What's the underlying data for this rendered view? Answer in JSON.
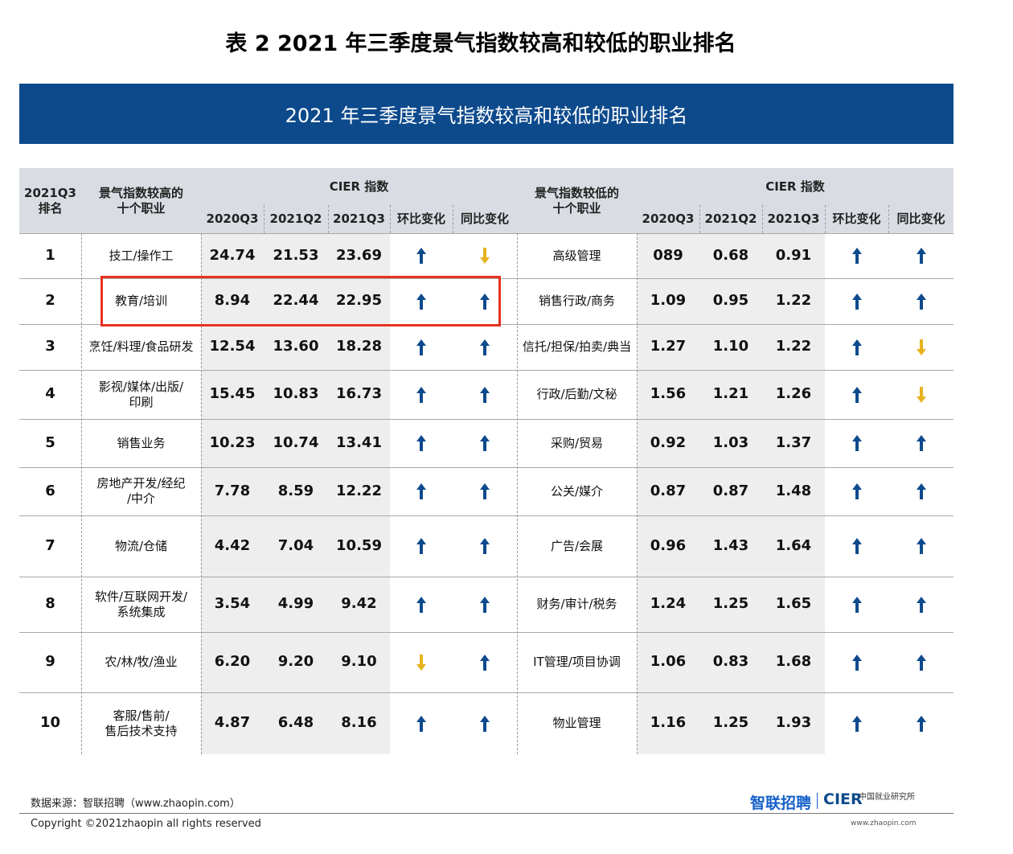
{
  "page_title": "表 2 2021 年三季度景气指数较高和较低的职业排名",
  "banner_title": "2021 年三季度景气指数较高和较低的职业排名",
  "header": {
    "rank": "2021Q3\n排名",
    "high_occ": "景气指数较高的\n十个职业",
    "low_occ": "景气指数较低的\n十个职业",
    "cier_index": "CIER 指数",
    "col_2020q3": "2020Q3",
    "col_2021q2": "2021Q2",
    "col_2021q3": "2021Q3",
    "col_qoq": "环比变化",
    "col_yoy": "同比变化"
  },
  "colors": {
    "up": "#0d4a8c",
    "down": "#e6b31e",
    "highlight": "#e8321f",
    "banner": "#0d4a8c"
  },
  "rows": [
    {
      "rank": "1",
      "high": "技工/操作工",
      "h20q3": "24.74",
      "h21q2": "21.53",
      "h21q3": "23.69",
      "h_qoq": "up",
      "h_yoy": "down",
      "low": "高级管理",
      "l20q3": "089",
      "l21q2": "0.68",
      "l21q3": "0.91",
      "l_qoq": "up",
      "l_yoy": "up"
    },
    {
      "rank": "2",
      "high": "教育/培训",
      "h20q3": "8.94",
      "h21q2": "22.44",
      "h21q3": "22.95",
      "h_qoq": "up",
      "h_yoy": "up",
      "low": "销售行政/商务",
      "l20q3": "1.09",
      "l21q2": "0.95",
      "l21q3": "1.22",
      "l_qoq": "up",
      "l_yoy": "up"
    },
    {
      "rank": "3",
      "high": "烹饪/料理/食品研发",
      "h20q3": "12.54",
      "h21q2": "13.60",
      "h21q3": "18.28",
      "h_qoq": "up",
      "h_yoy": "up",
      "low": "信托/担保/拍卖/典当",
      "l20q3": "1.27",
      "l21q2": "1.10",
      "l21q3": "1.22",
      "l_qoq": "up",
      "l_yoy": "down"
    },
    {
      "rank": "4",
      "high": "影视/媒体/出版/\n印刷",
      "h20q3": "15.45",
      "h21q2": "10.83",
      "h21q3": "16.73",
      "h_qoq": "up",
      "h_yoy": "up",
      "low": "行政/后勤/文秘",
      "l20q3": "1.56",
      "l21q2": "1.21",
      "l21q3": "1.26",
      "l_qoq": "up",
      "l_yoy": "down"
    },
    {
      "rank": "5",
      "high": "销售业务",
      "h20q3": "10.23",
      "h21q2": "10.74",
      "h21q3": "13.41",
      "h_qoq": "up",
      "h_yoy": "up",
      "low": "采购/贸易",
      "l20q3": "0.92",
      "l21q2": "1.03",
      "l21q3": "1.37",
      "l_qoq": "up",
      "l_yoy": "up"
    },
    {
      "rank": "6",
      "high": "房地产开发/经纪\n/中介",
      "h20q3": "7.78",
      "h21q2": "8.59",
      "h21q3": "12.22",
      "h_qoq": "up",
      "h_yoy": "up",
      "low": "公关/媒介",
      "l20q3": "0.87",
      "l21q2": "0.87",
      "l21q3": "1.48",
      "l_qoq": "up",
      "l_yoy": "up"
    },
    {
      "rank": "7",
      "high": "物流/仓储",
      "h20q3": "4.42",
      "h21q2": "7.04",
      "h21q3": "10.59",
      "h_qoq": "up",
      "h_yoy": "up",
      "low": "广告/会展",
      "l20q3": "0.96",
      "l21q2": "1.43",
      "l21q3": "1.64",
      "l_qoq": "up",
      "l_yoy": "up"
    },
    {
      "rank": "8",
      "high": "软件/互联网开发/\n系统集成",
      "h20q3": "3.54",
      "h21q2": "4.99",
      "h21q3": "9.42",
      "h_qoq": "up",
      "h_yoy": "up",
      "low": "财务/审计/税务",
      "l20q3": "1.24",
      "l21q2": "1.25",
      "l21q3": "1.65",
      "l_qoq": "up",
      "l_yoy": "up"
    },
    {
      "rank": "9",
      "high": "农/林/牧/渔业",
      "h20q3": "6.20",
      "h21q2": "9.20",
      "h21q3": "9.10",
      "h_qoq": "down",
      "h_yoy": "up",
      "low": "IT管理/项目协调",
      "l20q3": "1.06",
      "l21q2": "0.83",
      "l21q3": "1.68",
      "l_qoq": "up",
      "l_yoy": "up"
    },
    {
      "rank": "10",
      "high": "客服/售前/\n售后技术支持",
      "h20q3": "4.87",
      "h21q2": "6.48",
      "h21q3": "8.16",
      "h_qoq": "up",
      "h_yoy": "up",
      "low": "物业管理",
      "l20q3": "1.16",
      "l21q2": "1.25",
      "l21q3": "1.93",
      "l_qoq": "up",
      "l_yoy": "up"
    }
  ],
  "footer": {
    "source": "数据来源：智联招聘（www.zhaopin.com）",
    "copyright": "Copyright ©2021zhaopin all rights reserved",
    "logo_zhilian": "智联招聘",
    "logo_cier": "CIER",
    "logo_cier_cn": "中国就业研究所",
    "logo_url": "www.zhaopin.com"
  }
}
